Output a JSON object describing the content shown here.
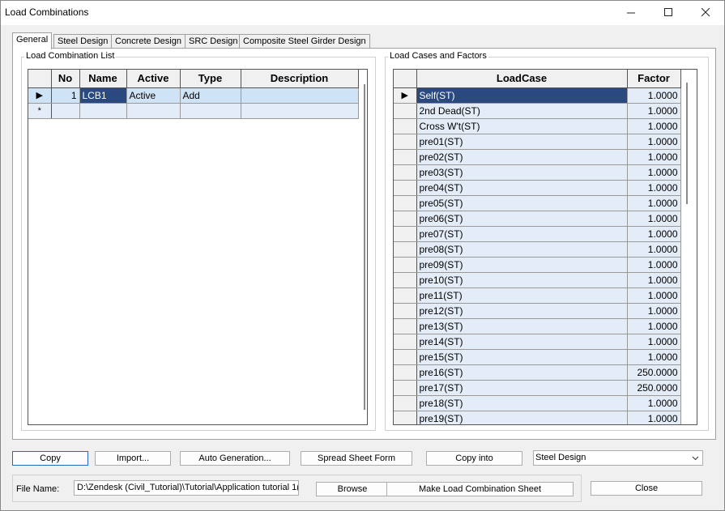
{
  "window": {
    "title": "Load Combinations",
    "minimize_icon": "minimize-icon",
    "maximize_icon": "maximize-icon",
    "close_icon": "close-icon"
  },
  "tabs": [
    {
      "label": "General",
      "active": true
    },
    {
      "label": "Steel Design",
      "active": false
    },
    {
      "label": "Concrete Design",
      "active": false
    },
    {
      "label": "SRC Design",
      "active": false
    },
    {
      "label": "Composite Steel Girder Design",
      "active": false
    }
  ],
  "combination_list": {
    "group_label": "Load Combination List",
    "columns": [
      "No",
      "Name",
      "Active",
      "Type",
      "Description"
    ],
    "rows": [
      {
        "marker": "▶",
        "no": "1",
        "name": "LCB1",
        "active": "Active",
        "type": "Add",
        "description": ""
      },
      {
        "marker": "*",
        "no": "",
        "name": "",
        "active": "",
        "type": "",
        "description": ""
      }
    ]
  },
  "load_cases": {
    "group_label": "Load Cases and Factors",
    "columns": [
      "LoadCase",
      "Factor"
    ],
    "rows": [
      {
        "marker": "▶",
        "name": "Self(ST)",
        "factor": "1.0000"
      },
      {
        "marker": "",
        "name": "2nd Dead(ST)",
        "factor": "1.0000"
      },
      {
        "marker": "",
        "name": "Cross W't(ST)",
        "factor": "1.0000"
      },
      {
        "marker": "",
        "name": "pre01(ST)",
        "factor": "1.0000"
      },
      {
        "marker": "",
        "name": "pre02(ST)",
        "factor": "1.0000"
      },
      {
        "marker": "",
        "name": "pre03(ST)",
        "factor": "1.0000"
      },
      {
        "marker": "",
        "name": "pre04(ST)",
        "factor": "1.0000"
      },
      {
        "marker": "",
        "name": "pre05(ST)",
        "factor": "1.0000"
      },
      {
        "marker": "",
        "name": "pre06(ST)",
        "factor": "1.0000"
      },
      {
        "marker": "",
        "name": "pre07(ST)",
        "factor": "1.0000"
      },
      {
        "marker": "",
        "name": "pre08(ST)",
        "factor": "1.0000"
      },
      {
        "marker": "",
        "name": "pre09(ST)",
        "factor": "1.0000"
      },
      {
        "marker": "",
        "name": "pre10(ST)",
        "factor": "1.0000"
      },
      {
        "marker": "",
        "name": "pre11(ST)",
        "factor": "1.0000"
      },
      {
        "marker": "",
        "name": "pre12(ST)",
        "factor": "1.0000"
      },
      {
        "marker": "",
        "name": "pre13(ST)",
        "factor": "1.0000"
      },
      {
        "marker": "",
        "name": "pre14(ST)",
        "factor": "1.0000"
      },
      {
        "marker": "",
        "name": "pre15(ST)",
        "factor": "1.0000"
      },
      {
        "marker": "",
        "name": "pre16(ST)",
        "factor": "250.0000"
      },
      {
        "marker": "",
        "name": "pre17(ST)",
        "factor": "250.0000"
      },
      {
        "marker": "",
        "name": "pre18(ST)",
        "factor": "1.0000"
      },
      {
        "marker": "",
        "name": "pre19(ST)",
        "factor": "1.0000"
      }
    ]
  },
  "buttons": {
    "copy": "Copy",
    "import": "Import...",
    "auto_generation": "Auto Generation...",
    "spread_sheet": "Spread Sheet Form",
    "copy_into": "Copy into",
    "browse": "Browse",
    "make_sheet": "Make Load Combination Sheet",
    "close": "Close"
  },
  "design_select": {
    "value": "Steel Design"
  },
  "file": {
    "label": "File Name:",
    "value": "D:\\Zendesk (Civil_Tutorial)\\Tutorial\\Application tutorial 1("
  },
  "colors": {
    "selection": "#2a4a7f",
    "row_highlight": "#cfe3f6",
    "grid_cell": "#e4ecf7",
    "primary_border": "#2a64c4"
  }
}
